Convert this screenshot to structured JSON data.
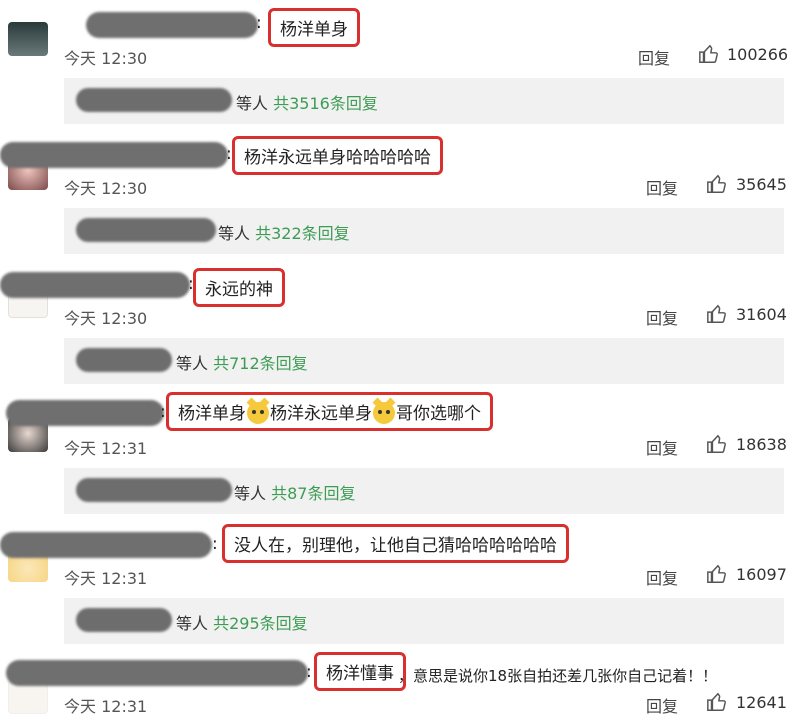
{
  "comments": [
    {
      "highlight": "杨洋单身",
      "rest": "",
      "time": "今天 12:30",
      "reply": "回复",
      "likes": "100266",
      "sub_suffix": "等人",
      "sub_link": "共3516条回复"
    },
    {
      "highlight": "杨洋永远单身哈哈哈哈哈",
      "rest": "",
      "time": "今天 12:30",
      "reply": "回复",
      "likes": "35645",
      "sub_suffix": "等人",
      "sub_link": "共322条回复"
    },
    {
      "highlight": "永远的神",
      "rest": "",
      "time": "今天 12:30",
      "reply": "回复",
      "likes": "31604",
      "sub_suffix": "等人",
      "sub_link": "共712条回复"
    },
    {
      "highlight_parts": [
        "杨洋单身",
        "杨洋永远单身",
        "哥你选哪个"
      ],
      "emoji": "cat-emoji",
      "rest": "",
      "time": "今天 12:31",
      "reply": "回复",
      "likes": "18638",
      "sub_suffix": "等人",
      "sub_link": "共87条回复"
    },
    {
      "highlight": "没人在，别理他，让他自己猜哈哈哈哈哈哈",
      "rest": "",
      "time": "今天 12:31",
      "reply": "回复",
      "likes": "16097",
      "sub_suffix": "等人",
      "sub_link": "共295条回复"
    },
    {
      "highlight": "杨洋懂事",
      "rest": "，意思是说你18张自拍还差几张你自己记着！！",
      "time": "今天 12:31",
      "reply": "回复",
      "likes": "12641"
    }
  ],
  "colors": {
    "highlight_border": "#d8302f",
    "link": "#3d9c54",
    "subpanel_bg": "#f1f1f1"
  },
  "icons": {
    "like": "thumbs-up-icon"
  }
}
